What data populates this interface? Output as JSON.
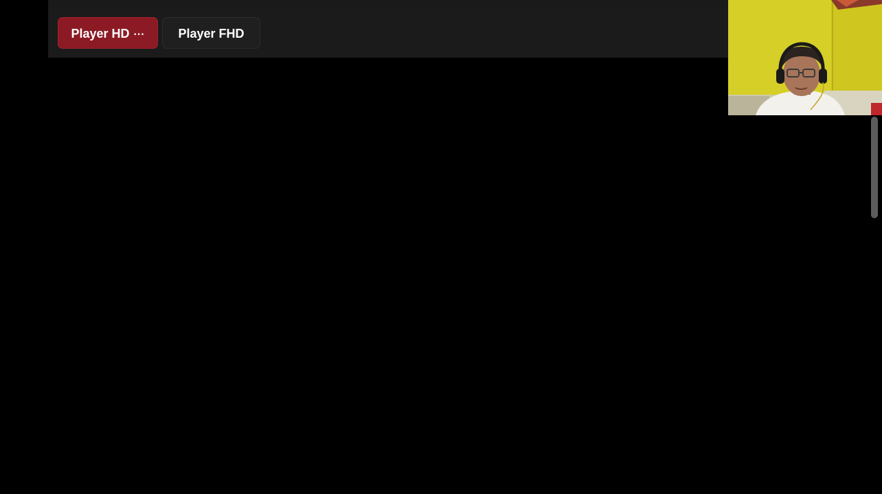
{
  "player_bar": {
    "tabs": [
      {
        "label": "Player HD",
        "active": true,
        "menu_icon": "ellipsis-icon",
        "menu_glyph": "···"
      },
      {
        "label": "Player FHD",
        "active": false
      }
    ]
  },
  "colors": {
    "background": "#000000",
    "bar": "#1b1b1b",
    "active_tab": "#8b1a24",
    "inactive_tab": "#1f1f1f",
    "tab_text": "#ffffff",
    "webcam_wall": "#d8d22a"
  },
  "webcam_overlay": {
    "icon": "webcam-feed"
  }
}
